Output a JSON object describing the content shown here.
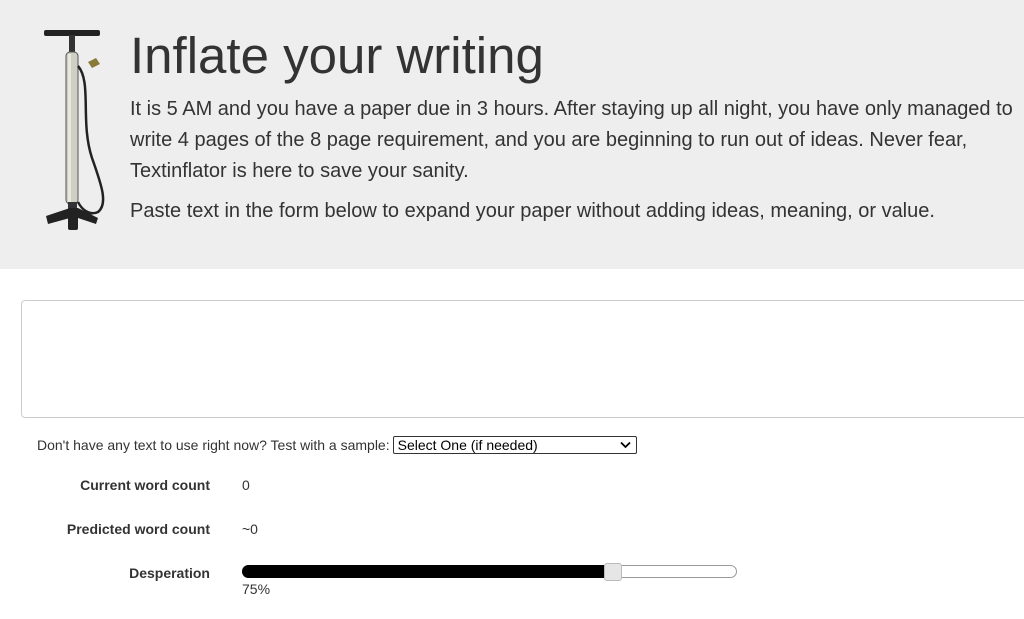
{
  "header": {
    "title": "Inflate your writing",
    "intro": "It is 5 AM and you have a paper due in 3 hours. After staying up all night, you have only managed to write 4 pages of the 8 page requirement, and you are beginning to run out of ideas. Never fear, Textinflator is here to save your sanity.",
    "instructions": "Paste text in the form below to expand your paper without adding ideas, meaning, or value.",
    "logo_icon": "tire-pump-icon"
  },
  "editor": {
    "value": "",
    "placeholder": ""
  },
  "sample": {
    "prompt": "Don't have any text to use right now? Test with a sample:",
    "selected": "Select One (if needed)"
  },
  "stats": {
    "current_label": "Current word count",
    "current_value": "0",
    "predicted_label": "Predicted word count",
    "predicted_value": "~0"
  },
  "desperation": {
    "label": "Desperation",
    "percent": 75,
    "display": "75%"
  }
}
